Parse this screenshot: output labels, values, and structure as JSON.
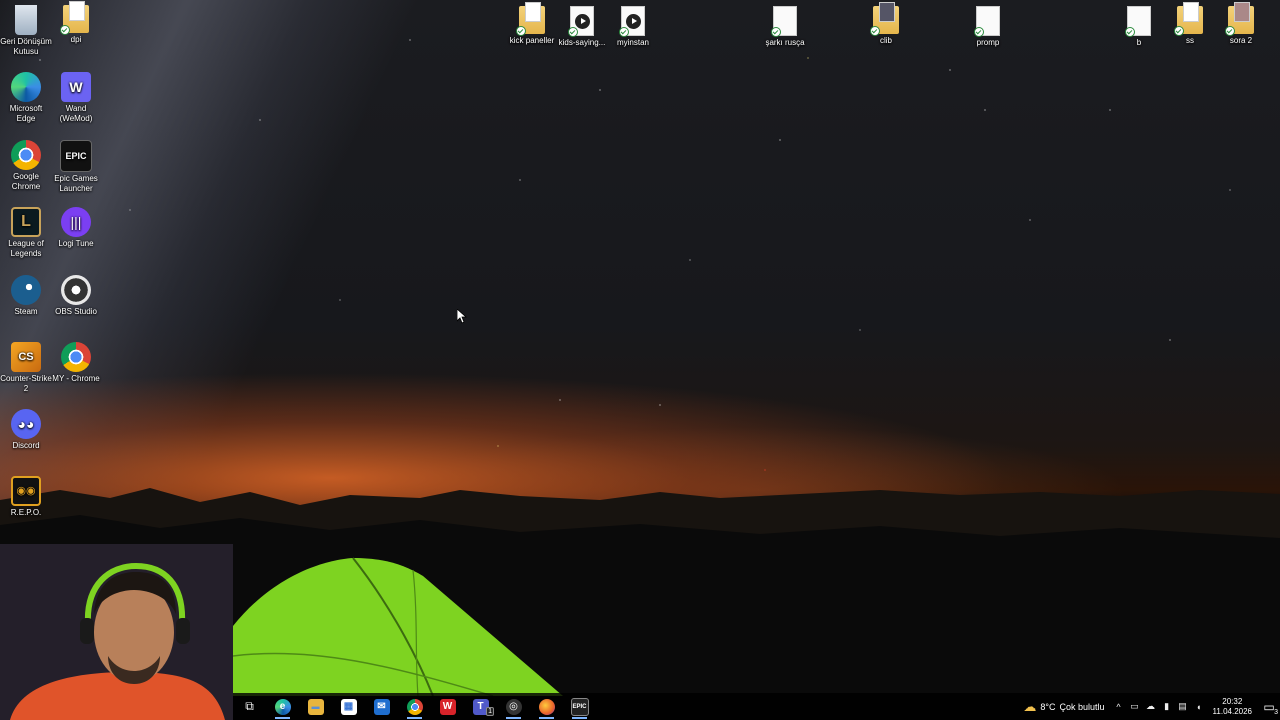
{
  "desktop": {
    "left_icons": [
      {
        "label": "Geri Dönüşüm Kutusu",
        "icon": "recycle-bin-icon"
      },
      {
        "label": "dpi",
        "icon": "folder-icon"
      },
      {
        "label": "Microsoft Edge",
        "icon": "edge-icon"
      },
      {
        "label": "Wand (WeMod)",
        "icon": "wemod-icon"
      },
      {
        "label": "Google Chrome",
        "icon": "chrome-icon"
      },
      {
        "label": "Epic Games Launcher",
        "icon": "epic-games-icon"
      },
      {
        "label": "League of Legends",
        "icon": "league-icon"
      },
      {
        "label": "Logi Tune",
        "icon": "logi-tune-icon"
      },
      {
        "label": "Steam",
        "icon": "steam-icon"
      },
      {
        "label": "OBS Studio",
        "icon": "obs-icon"
      },
      {
        "label": "Counter-Strike 2",
        "icon": "cs2-icon"
      },
      {
        "label": "MY - Chrome",
        "icon": "chrome-icon"
      },
      {
        "label": "Discord",
        "icon": "discord-icon"
      },
      {
        "label": "R.E.P.O.",
        "icon": "repo-icon"
      }
    ],
    "top_icons": [
      {
        "label": "kick paneller",
        "icon": "folder-icon"
      },
      {
        "label": "kids-saying...",
        "icon": "video-file-icon"
      },
      {
        "label": "myinstan",
        "icon": "video-file-icon"
      },
      {
        "label": "şarkı rusça",
        "icon": "file-icon"
      },
      {
        "label": "clib",
        "icon": "folder-icon"
      },
      {
        "label": "promp",
        "icon": "file-icon"
      },
      {
        "label": "b",
        "icon": "file-icon"
      },
      {
        "label": "ss",
        "icon": "folder-icon"
      },
      {
        "label": "sora 2",
        "icon": "folder-icon"
      }
    ]
  },
  "taskbar": {
    "apps": [
      {
        "name": "task-view-icon",
        "glyph": "⧉",
        "color": "#2a2a2a"
      },
      {
        "name": "edge-icon",
        "glyph": "e",
        "color": "#1b8fd8"
      },
      {
        "name": "file-explorer-icon",
        "glyph": "▬",
        "color": "#e8b53e"
      },
      {
        "name": "store-icon",
        "glyph": "▦",
        "color": "#3a76d6"
      },
      {
        "name": "mail-icon",
        "glyph": "✉",
        "color": "#1f6ecf"
      },
      {
        "name": "chrome-icon",
        "glyph": "◉",
        "color": "#d9412f"
      },
      {
        "name": "wps-office-icon",
        "glyph": "W",
        "color": "#d8232a"
      },
      {
        "name": "teams-icon",
        "glyph": "T",
        "color": "#5059c9"
      },
      {
        "name": "obs-icon",
        "glyph": "◎",
        "color": "#333"
      },
      {
        "name": "firefox-icon",
        "glyph": "●",
        "color": "#e8622a"
      },
      {
        "name": "epic-games-icon",
        "glyph": "EPIC",
        "color": "#222"
      }
    ],
    "teams_badge": "1",
    "weather": {
      "temp": "8°C",
      "text": "Çok bulutlu"
    },
    "tray_icons": [
      "chevron-up-icon",
      "meet-now-icon",
      "onedrive-icon",
      "microphone-icon",
      "network-icon",
      "volume-icon"
    ],
    "clock": {
      "time": "20:32",
      "date": "11.04.2026"
    },
    "notification_count": "3"
  },
  "colors": {
    "taskbar_bg": "#000000",
    "active_indicator": "#7fb6ff",
    "tent": "#7ed321"
  }
}
